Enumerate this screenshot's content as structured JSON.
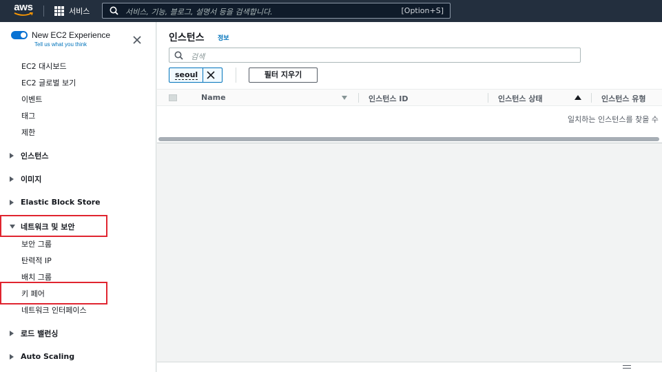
{
  "topnav": {
    "logo_text": "aws",
    "services_label": "서비스",
    "search_placeholder": "서비스, 기능, 블로그, 설명서 등을 검색합니다.",
    "search_shortcut": "[Option+S]"
  },
  "sidebar": {
    "new_experience_label": "New EC2 Experience",
    "new_experience_enabled": true,
    "feedback_link": "Tell us what you think",
    "top_links": [
      "EC2 대시보드",
      "EC2 글로벌 보기",
      "이벤트",
      "태그",
      "제한"
    ],
    "sections": {
      "instances": "인스턴스",
      "images": "이미지",
      "ebs": "Elastic Block Store",
      "network_security": "네트워크 및 보안",
      "load_balancing": "로드 밸런싱",
      "auto_scaling": "Auto Scaling"
    },
    "network_links": [
      "보안 그룹",
      "탄력적 IP",
      "배치 그룹",
      "키 페어",
      "네트워크 인터페이스"
    ]
  },
  "main": {
    "title": "인스턴스",
    "info_link": "정보",
    "filter_placeholder": "검색",
    "filter_token": "seoul",
    "clear_filters_label": "필터 지우기",
    "columns": [
      "Name",
      "인스턴스 ID",
      "인스턴스 상태",
      "인스턴스 유형"
    ],
    "empty_message": "일치하는 인스턴스를 찾을 수"
  },
  "colors": {
    "nav_bg": "#232f3e",
    "link": "#0073bb",
    "highlight": "#e0242f"
  }
}
